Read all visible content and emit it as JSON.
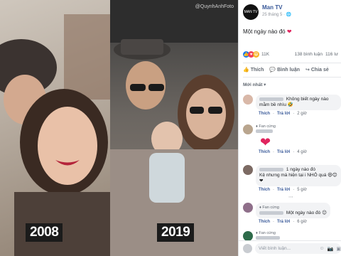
{
  "photos": {
    "left_year": "2008",
    "right_year": "2019",
    "watermark": "@QuynhAnhFoto"
  },
  "post": {
    "page_name": "Man TV",
    "page_avatar_text": "MAN TV",
    "time": "25 tháng 5",
    "body": "Một ngày nào đó",
    "reaction_count": "11K",
    "comments_count": "138 bình luận",
    "shares_count": "116 lư",
    "actions": {
      "like": "Thích",
      "comment": "Bình luận",
      "share": "Chia sẻ"
    },
    "sort_label": "Mới nhất ▾"
  },
  "comments": [
    {
      "text": "Không biết ngày nào mằm bề nhìu",
      "emoji": "🤣",
      "like": "Thích",
      "reply": "Trả lời",
      "time": "2 giờ",
      "avatar_color": "#d9b8a8"
    },
    {
      "badge": "Fan cứng",
      "like": "Thích",
      "reply": "Trả lời",
      "time": "4 giờ",
      "avatar_color": "#b9a58e"
    },
    {
      "text": "1 ngày nào đó",
      "text2": "Kệ nhưng mà hiện tại i NHỎ quá",
      "emoji": "😆😊❤",
      "like": "Thích",
      "reply": "Trả lời",
      "time": "5 giờ",
      "avatar_color": "#7c6a63"
    },
    {
      "reply_link": "⋯",
      "badge": "Fan cứng",
      "text": "Một ngày nào đó",
      "emoji": "😉",
      "like": "Thích",
      "reply": "Trả lời",
      "time": "6 giờ",
      "avatar_color": "#8f6f8a"
    },
    {
      "badge": "Fan cứng",
      "avatar_color": "#2e6b4a"
    }
  ],
  "input": {
    "placeholder": "Viết bình luận..."
  },
  "colors": {
    "link": "#385898",
    "like_blue": "#1877f2",
    "love_red": "#e0245e"
  }
}
